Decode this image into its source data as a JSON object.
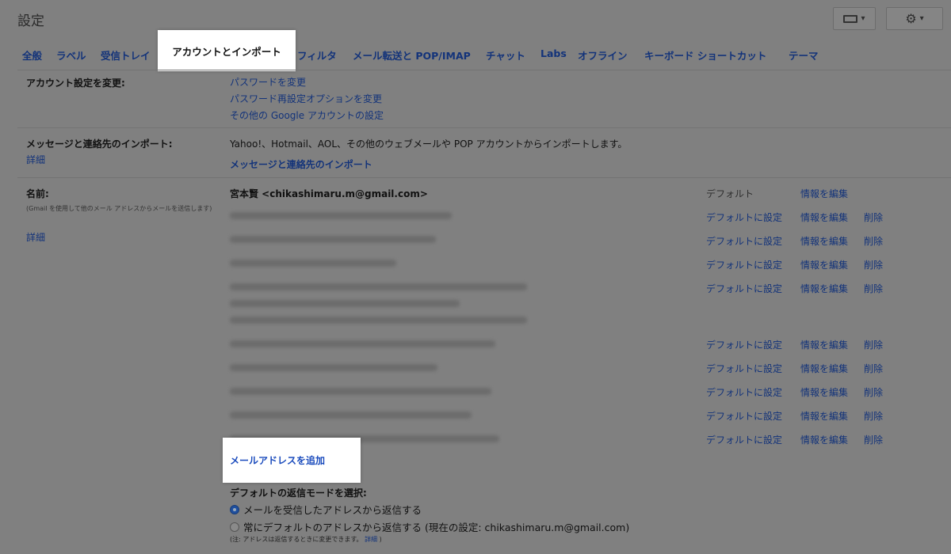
{
  "header": {
    "title": "設定",
    "keyboard_icon": "keyboard-icon",
    "gear_icon": "gear-icon"
  },
  "tabs": [
    {
      "label": "全般"
    },
    {
      "label": "ラベル"
    },
    {
      "label": "受信トレイ"
    },
    {
      "label": "アカウントとインポート",
      "active": true
    },
    {
      "label": "フィルタ"
    },
    {
      "label": "メール転送と POP/IMAP"
    },
    {
      "label": "チャット"
    },
    {
      "label": "Labs"
    },
    {
      "label": "オフライン"
    },
    {
      "label": "キーボード ショートカット"
    },
    {
      "label": "テーマ"
    }
  ],
  "account": {
    "label": "アカウント設定を変更:",
    "links": [
      "パスワードを変更",
      "パスワード再設定オプションを変更",
      "その他の Google アカウントの設定"
    ]
  },
  "import": {
    "label": "メッセージと連絡先のインポート:",
    "detail_link": "詳細",
    "description": "Yahoo!、Hotmail、AOL、その他のウェブメールや POP アカウントからインポートします。",
    "action_link": "メッセージと連絡先のインポート"
  },
  "name": {
    "label": "名前:",
    "sublabel": "(Gmail を使用して他のメール アドレスからメールを送信します)",
    "detail_link": "詳細",
    "primary": "宮本賢 <chikashimaru.m@gmail.com>",
    "default_text": "デフォルト",
    "edit_info": "情報を編集",
    "set_default": "デフォルトに設定",
    "delete": "削除",
    "add_address": "メールアドレスを追加"
  },
  "reply_mode": {
    "label": "デフォルトの返信モードを選択:",
    "option1": "メールを受信したアドレスから返信する",
    "option2": "常にデフォルトのアドレスから返信する (現在の設定: chikashimaru.m@gmail.com)",
    "note": "(注: アドレスは返信するときに変更できます。",
    "note_link": "詳細",
    "note_close": ")"
  }
}
